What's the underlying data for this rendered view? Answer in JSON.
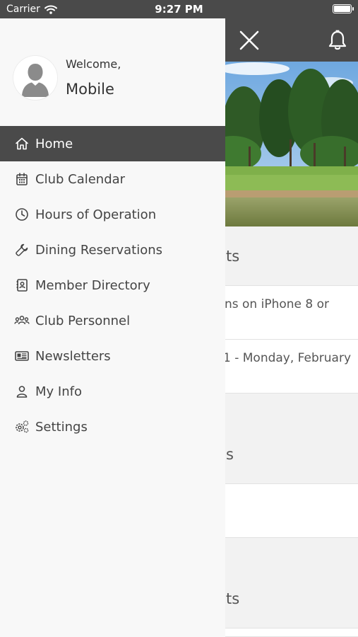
{
  "status_bar": {
    "carrier": "Carrier",
    "time": "9:27 PM",
    "battery_level": 1.0
  },
  "drawer": {
    "welcome_text": "Welcome,",
    "user_name": "Mobile",
    "menu": [
      {
        "label": "Home",
        "icon": "home-icon",
        "active": true
      },
      {
        "label": "Club Calendar",
        "icon": "calendar-icon",
        "active": false
      },
      {
        "label": "Hours of Operation",
        "icon": "clock-icon",
        "active": false
      },
      {
        "label": "Dining Reservations",
        "icon": "wrench-icon",
        "active": false
      },
      {
        "label": "Member Directory",
        "icon": "contact-book-icon",
        "active": false
      },
      {
        "label": "Club Personnel",
        "icon": "group-icon",
        "active": false
      },
      {
        "label": "Newsletters",
        "icon": "newspaper-icon",
        "active": false
      },
      {
        "label": "My Info",
        "icon": "person-icon",
        "active": false
      },
      {
        "label": "Settings",
        "icon": "gears-icon",
        "active": false
      }
    ]
  },
  "background": {
    "section1_fragment": "ts",
    "row1_fragment": "ns on iPhone 8 or",
    "row2_fragment": "1 - Monday, February",
    "section2_fragment": "s",
    "section3_fragment": "ts"
  },
  "colors": {
    "header_bg": "#4a4a4a",
    "drawer_bg": "#f8f8f8",
    "active_item_bg": "#4a4a4a",
    "text": "#444444"
  }
}
